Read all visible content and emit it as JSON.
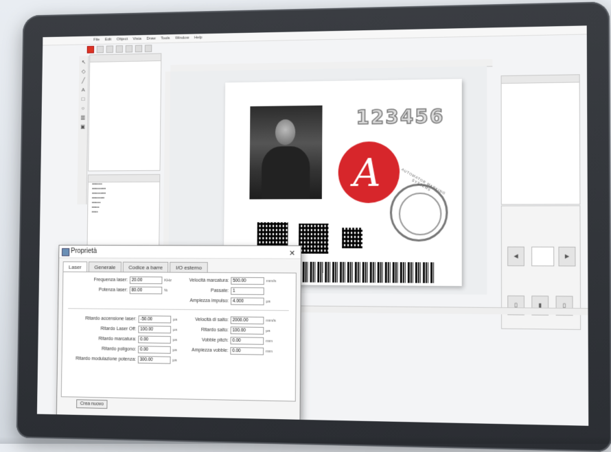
{
  "menu": [
    "File",
    "Edit",
    "Object",
    "Vista",
    "Draw",
    "Tools",
    "Window",
    "Help"
  ],
  "canvas": {
    "serial_number": "123456",
    "logo_letter": "A",
    "stamp_text": "AUTOMATOR MARKING SYSTEMS"
  },
  "dialog": {
    "title": "Proprietà",
    "close": "✕",
    "tabs": [
      "Laser",
      "Generale",
      "Codice a barre",
      "I/O esterno"
    ],
    "active_tab": "Laser",
    "fields_top": [
      {
        "label": "Frequenza laser:",
        "value": "20.00",
        "unit": "KHz"
      },
      {
        "label": "Potenza laser:",
        "value": "80.00",
        "unit": "%"
      }
    ],
    "fields_top_right": [
      {
        "label": "Velocità marcatura:",
        "value": "500.00",
        "unit": "mm/s"
      },
      {
        "label": "Passate:",
        "value": "1",
        "unit": ""
      },
      {
        "label": "Ampiezza impulso:",
        "value": "4.000",
        "unit": "µs"
      }
    ],
    "fields_bottom_left": [
      {
        "label": "Ritardo accensione laser:",
        "value": "-50.00",
        "unit": "µs"
      },
      {
        "label": "Ritardo Laser Off:",
        "value": "100.00",
        "unit": "µs"
      },
      {
        "label": "Ritardo marcatura:",
        "value": "0.00",
        "unit": "µs"
      },
      {
        "label": "Ritardo poligono:",
        "value": "0.00",
        "unit": "µs"
      },
      {
        "label": "Ritardo modulazione potenza:",
        "value": "300.00",
        "unit": "µs"
      }
    ],
    "fields_bottom_right": [
      {
        "label": "Velocità di salto:",
        "value": "2000.00",
        "unit": "mm/s"
      },
      {
        "label": "Ritardo salto:",
        "value": "100.00",
        "unit": "µs"
      },
      {
        "label": "Vobble pitch:",
        "value": "0.00",
        "unit": "mm"
      },
      {
        "label": "Ampiezza vobble:",
        "value": "0.00",
        "unit": "mm"
      }
    ],
    "reset_label": "Crea nuovo"
  }
}
